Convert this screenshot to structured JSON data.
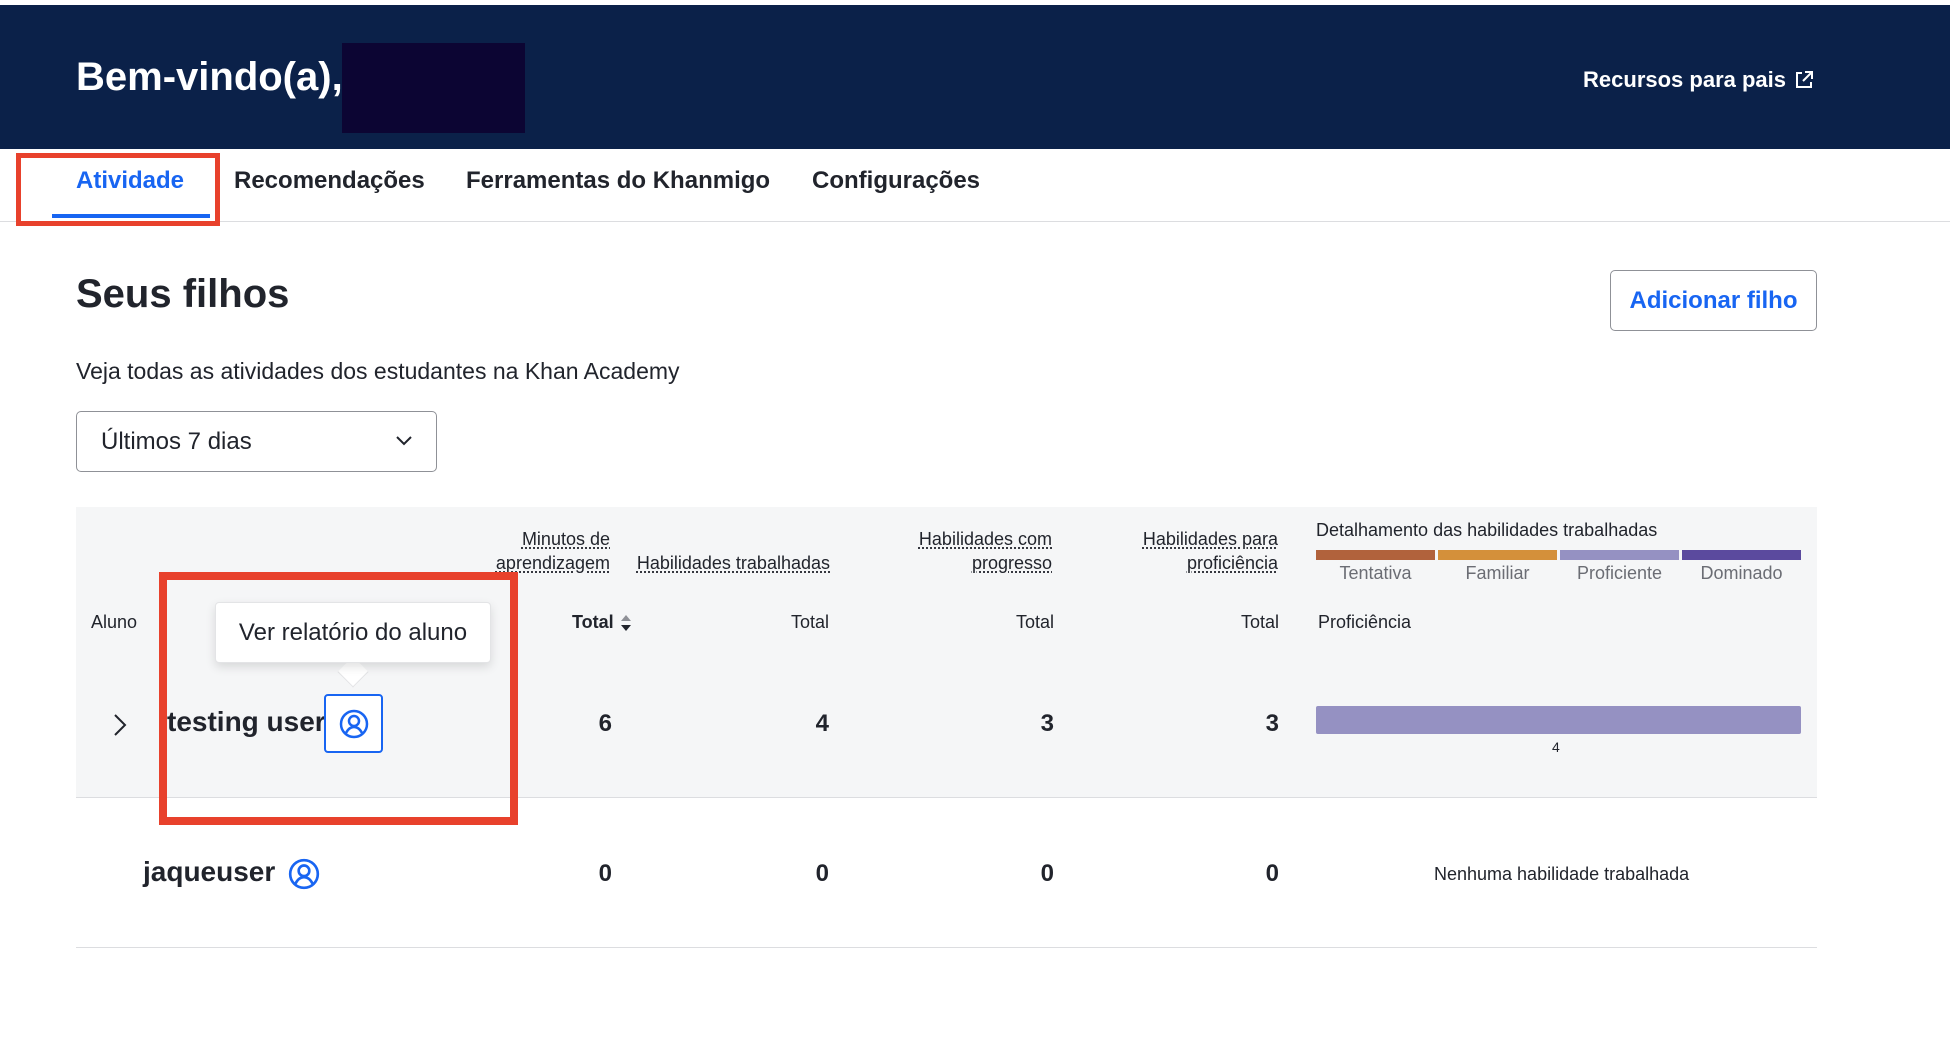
{
  "header": {
    "welcome": "Bem-vindo(a),",
    "parent_resources": "Recursos para pais",
    "external_icon": "external-link-icon",
    "bg_color": "#0b2149"
  },
  "tabs": [
    {
      "label": "Atividade",
      "active": true
    },
    {
      "label": "Recomendações",
      "active": false
    },
    {
      "label": "Ferramentas do Khanmigo",
      "active": false
    },
    {
      "label": "Configurações",
      "active": false
    }
  ],
  "page": {
    "title": "Seus filhos",
    "subtitle": "Veja todas as atividades dos estudantes na Khan Academy",
    "add_child": "Adicionar filho",
    "period_selected": "Últimos 7 dias"
  },
  "table": {
    "student_header": "Aluno",
    "col_minutes_1": "Minutos de",
    "col_minutes_2": "aprendizagem",
    "col_worked": "Habilidades trabalhadas",
    "col_progress_1": "Habilidades com",
    "col_progress_2": "progresso",
    "col_prof_1": "Habilidades para",
    "col_prof_2": "proficiência",
    "breakdown_title": "Detalhamento das habilidades trabalhadas",
    "sub_total": "Total",
    "sub_proficiency": "Proficiência",
    "legend": [
      {
        "label": "Tentativa",
        "color": "#b1623c"
      },
      {
        "label": "Familiar",
        "color": "#d4903a"
      },
      {
        "label": "Proficiente",
        "color": "#9591c2"
      },
      {
        "label": "Dominado",
        "color": "#5b4a9e"
      }
    ],
    "rows": [
      {
        "name": "testing user",
        "minutes": "6",
        "worked": "4",
        "progress": "3",
        "proficient": "3",
        "bar_count": "4"
      },
      {
        "name": "jaqueuser",
        "minutes": "0",
        "worked": "0",
        "progress": "0",
        "proficient": "0",
        "empty_text": "Nenhuma habilidade trabalhada"
      }
    ]
  },
  "tooltip": "Ver relatório do aluno",
  "colors": {
    "accent": "#1865f2",
    "highlight": "#e8412c"
  }
}
